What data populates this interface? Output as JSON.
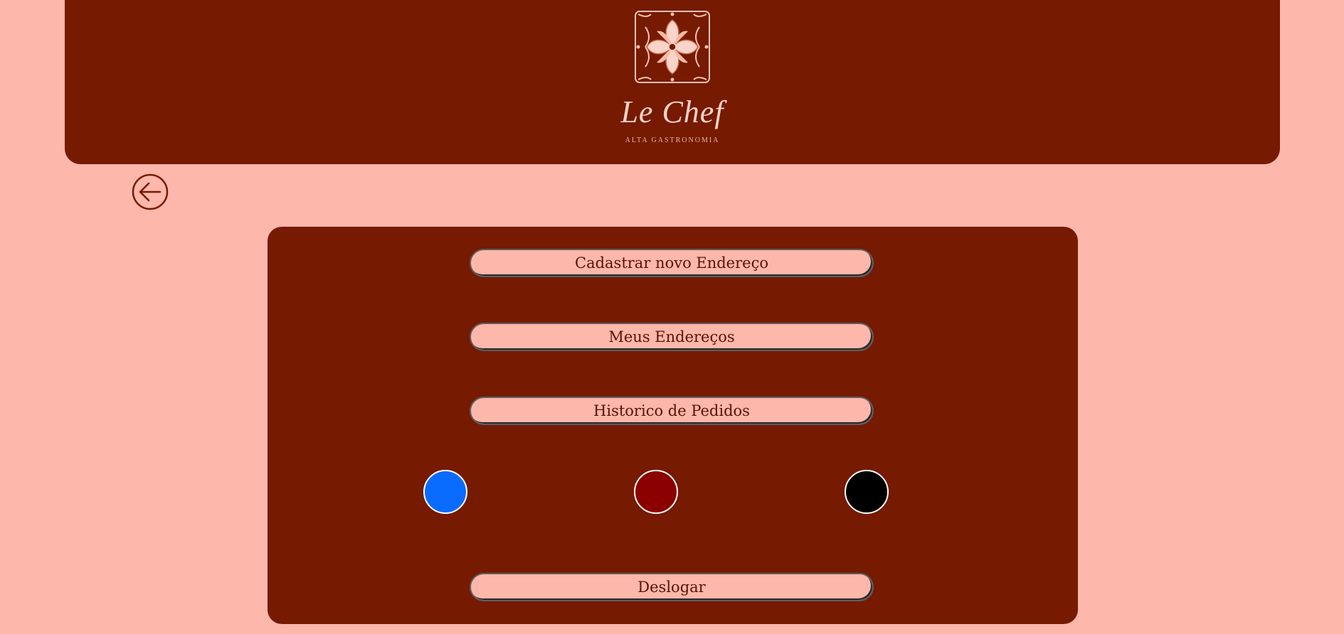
{
  "header": {
    "logo_name": "Le Chef",
    "logo_tagline": "ALTA GASTRONOMIA",
    "logo_icon": "flower-emblem-icon"
  },
  "navigation": {
    "back_icon": "arrow-left-circle-icon"
  },
  "menu": {
    "buttons": [
      {
        "label": "Cadastrar novo Endereço"
      },
      {
        "label": "Meus Endereços"
      },
      {
        "label": "Historico de Pedidos"
      }
    ],
    "logout_label": "Deslogar"
  },
  "theme_colors": [
    {
      "color": "#0a6cff"
    },
    {
      "color": "#8b0000"
    },
    {
      "color": "#000000"
    }
  ],
  "colors": {
    "background": "#fdb7ab",
    "primary": "#761a01",
    "button_text": "#5a1200",
    "logo_text": "#fbd4c9"
  }
}
